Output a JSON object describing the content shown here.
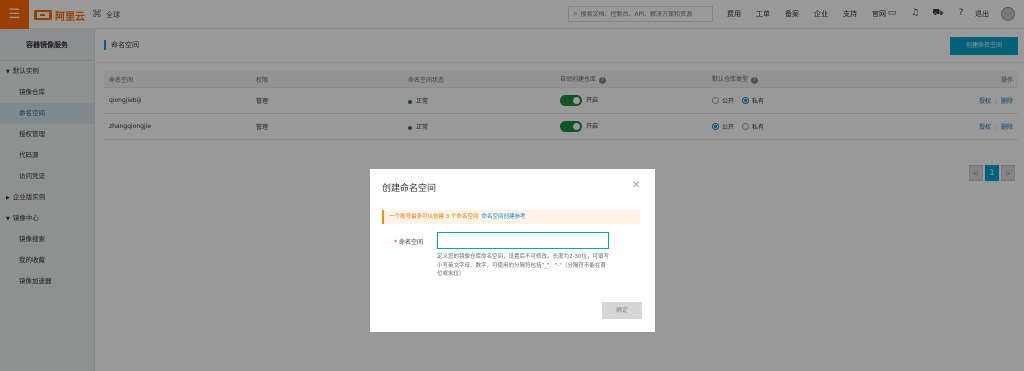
{
  "topbar": {
    "logo_text": "阿里云",
    "region": "全球",
    "search_placeholder": "搜索文档、控制台、API、解决方案和资源",
    "nav_links": [
      "费用",
      "工单",
      "备案",
      "企业",
      "支持",
      "官网"
    ],
    "logout": "退出"
  },
  "sidebar": {
    "title": "容器镜像服务",
    "group_default": "默认实例",
    "items_default": [
      "镜像仓库",
      "命名空间",
      "授权管理",
      "代码源",
      "访问凭证"
    ],
    "active_item": "命名空间",
    "group_enterprise": "企业版实例",
    "group_hub": "镜像中心",
    "items_hub": [
      "镜像搜索",
      "我的收藏",
      "镜像加速器"
    ]
  },
  "page": {
    "title": "命名空间",
    "create_button": "创建命名空间"
  },
  "table": {
    "headers": [
      "命名空间",
      "权限",
      "命名空间状态",
      "自动创建仓库",
      "默认仓库类型",
      "操作"
    ],
    "rows": [
      {
        "name": "qiongjiebiji",
        "permission": "管理",
        "status": "正常",
        "auto_create": "开启",
        "repo_type": "私有",
        "opt_public": "公开",
        "opt_private": "私有",
        "action_auth": "授权",
        "action_delete": "删除"
      },
      {
        "name": "zhangqiongjie",
        "permission": "管理",
        "status": "正常",
        "auto_create": "开启",
        "repo_type": "公开",
        "opt_public": "公开",
        "opt_private": "私有",
        "action_auth": "授权",
        "action_delete": "删除"
      }
    ]
  },
  "pager": {
    "prev": "<",
    "current": "1",
    "next": ">"
  },
  "dialog": {
    "title": "创建命名空间",
    "notice": "一个账号最多可以创建 3 个命名空间",
    "notice_link": "命名空间创建参考",
    "field_label": "命名空间",
    "input_value": "",
    "hint": "定义您的镜像仓库命名空间，设置后不可修改。长度为2-30位，可填写小写英文字母、数字，可使用的分隔符包括\"_\"、\"-\"（分隔符不能在首位或末位）",
    "ok_button": "确定"
  },
  "colors": {
    "accent": "#00a2ca",
    "brand": "#ff6a00",
    "status_ok": "#1e8e3e"
  }
}
